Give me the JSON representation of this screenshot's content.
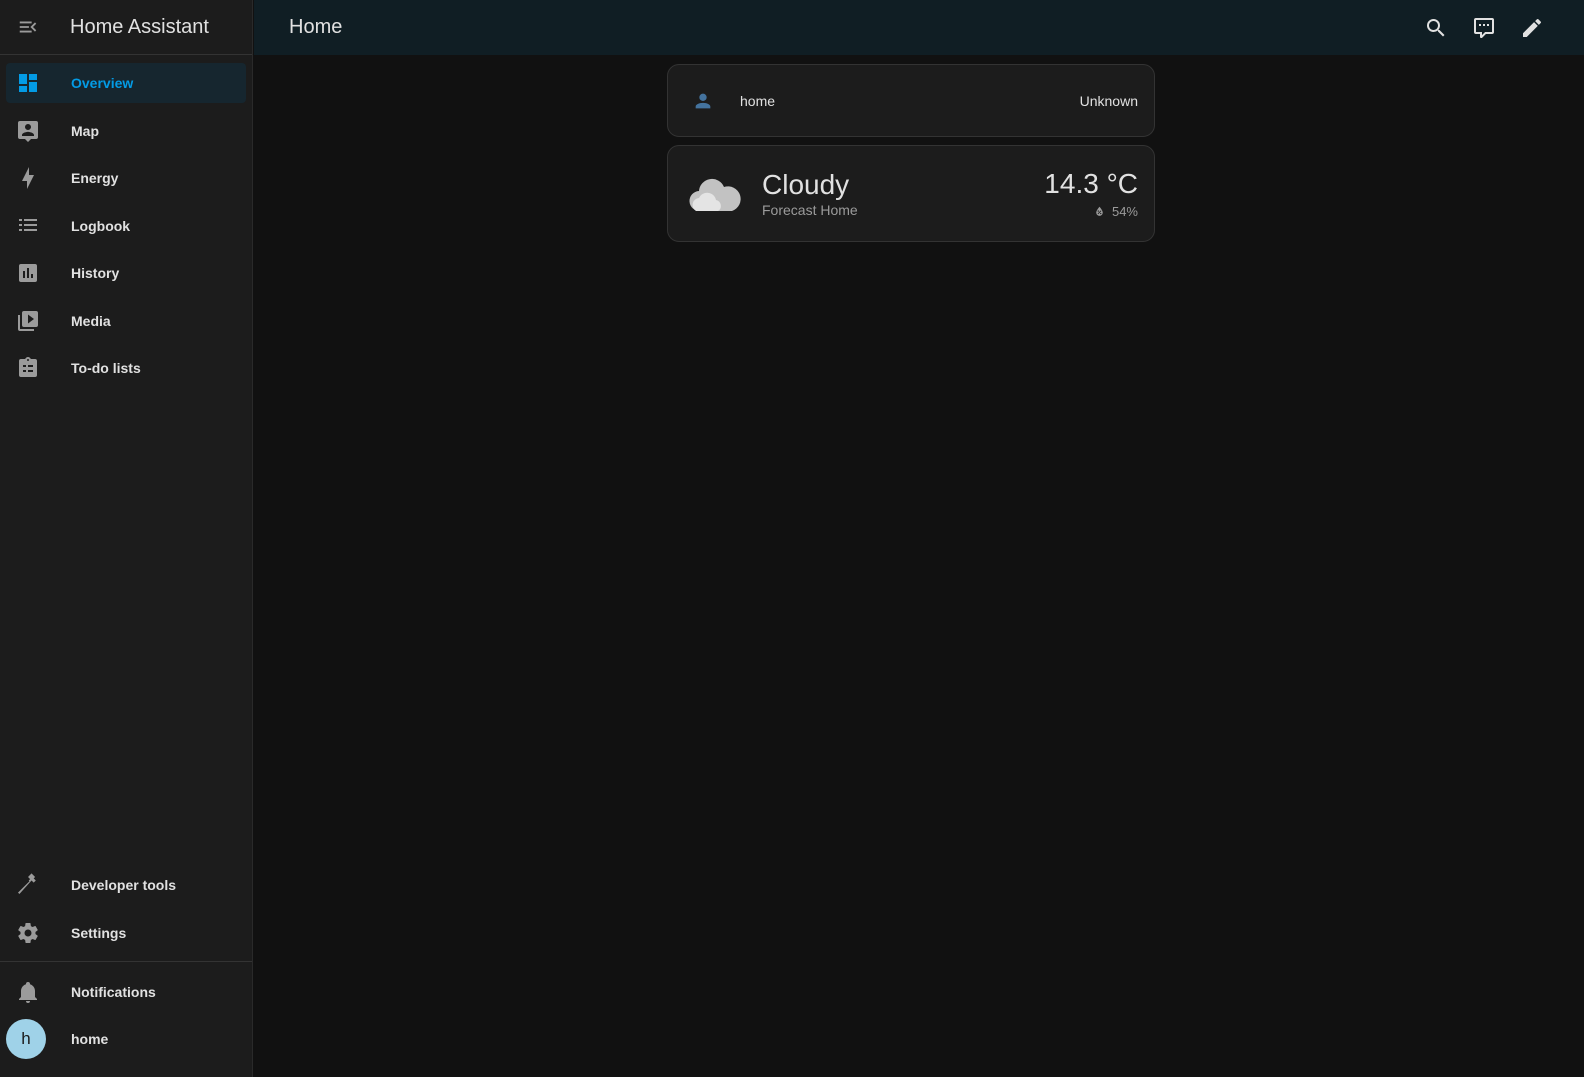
{
  "sidebar": {
    "title": "Home Assistant",
    "items": [
      {
        "label": "Overview",
        "icon": "view-dashboard-icon",
        "active": true
      },
      {
        "label": "Map",
        "icon": "map-account-icon"
      },
      {
        "label": "Energy",
        "icon": "lightning-bolt-icon"
      },
      {
        "label": "Logbook",
        "icon": "format-list-bulleted-icon"
      },
      {
        "label": "History",
        "icon": "chart-box-icon"
      },
      {
        "label": "Media",
        "icon": "play-box-multiple-icon"
      },
      {
        "label": "To-do lists",
        "icon": "clipboard-list-icon"
      }
    ],
    "developer_tools": "Developer tools",
    "settings": "Settings",
    "notifications": "Notifications",
    "user": {
      "initial": "h",
      "name": "home"
    }
  },
  "header": {
    "title": "Home"
  },
  "cards": {
    "person": {
      "name": "home",
      "state": "Unknown"
    },
    "weather": {
      "condition": "Cloudy",
      "name": "Forecast Home",
      "temperature": "14.3 °C",
      "humidity": "54%"
    }
  },
  "colors": {
    "accent": "#039be5",
    "person_icon": "#44739e"
  }
}
